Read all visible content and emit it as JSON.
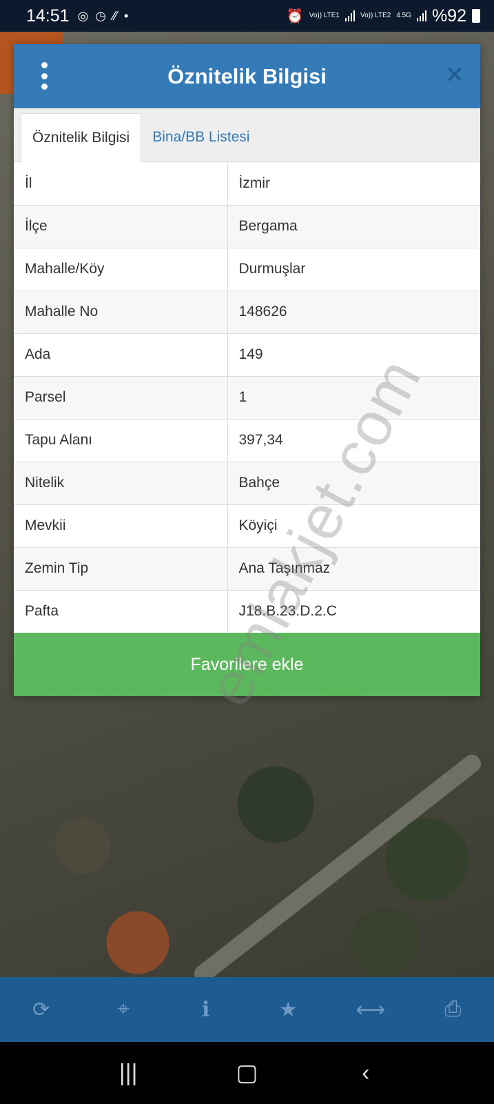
{
  "status_bar": {
    "time": "14:51",
    "net1": "Vo)) LTE1",
    "net2": "Vo)) LTE2",
    "net2_speed": "4.5G",
    "battery": "%92"
  },
  "dialog": {
    "title": "Öznitelik Bilgisi",
    "tabs": [
      {
        "label": "Öznitelik Bilgisi",
        "active": true
      },
      {
        "label": "Bina/BB Listesi",
        "active": false
      }
    ],
    "rows": [
      {
        "key": "İl",
        "value": "İzmir"
      },
      {
        "key": "İlçe",
        "value": "Bergama"
      },
      {
        "key": "Mahalle/Köy",
        "value": "Durmuşlar"
      },
      {
        "key": "Mahalle No",
        "value": "148626"
      },
      {
        "key": "Ada",
        "value": "149"
      },
      {
        "key": "Parsel",
        "value": "1"
      },
      {
        "key": "Tapu Alanı",
        "value": "397,34"
      },
      {
        "key": "Nitelik",
        "value": "Bahçe"
      },
      {
        "key": "Mevkii",
        "value": "Köyiçi"
      },
      {
        "key": "Zemin Tip",
        "value": "Ana Taşınmaz"
      },
      {
        "key": "Pafta",
        "value": "J18.B.23.D.2.C"
      }
    ],
    "favorite_button": "Favorilere ekle"
  },
  "watermark": "emlakjet.com",
  "toolbar": {
    "icons": [
      "refresh-icon",
      "locate-icon",
      "info-icon",
      "star-icon",
      "measure-icon",
      "print-icon"
    ]
  },
  "colors": {
    "header": "#337ab7",
    "button": "#5cb85c",
    "toolbar": "#1d5b91"
  }
}
